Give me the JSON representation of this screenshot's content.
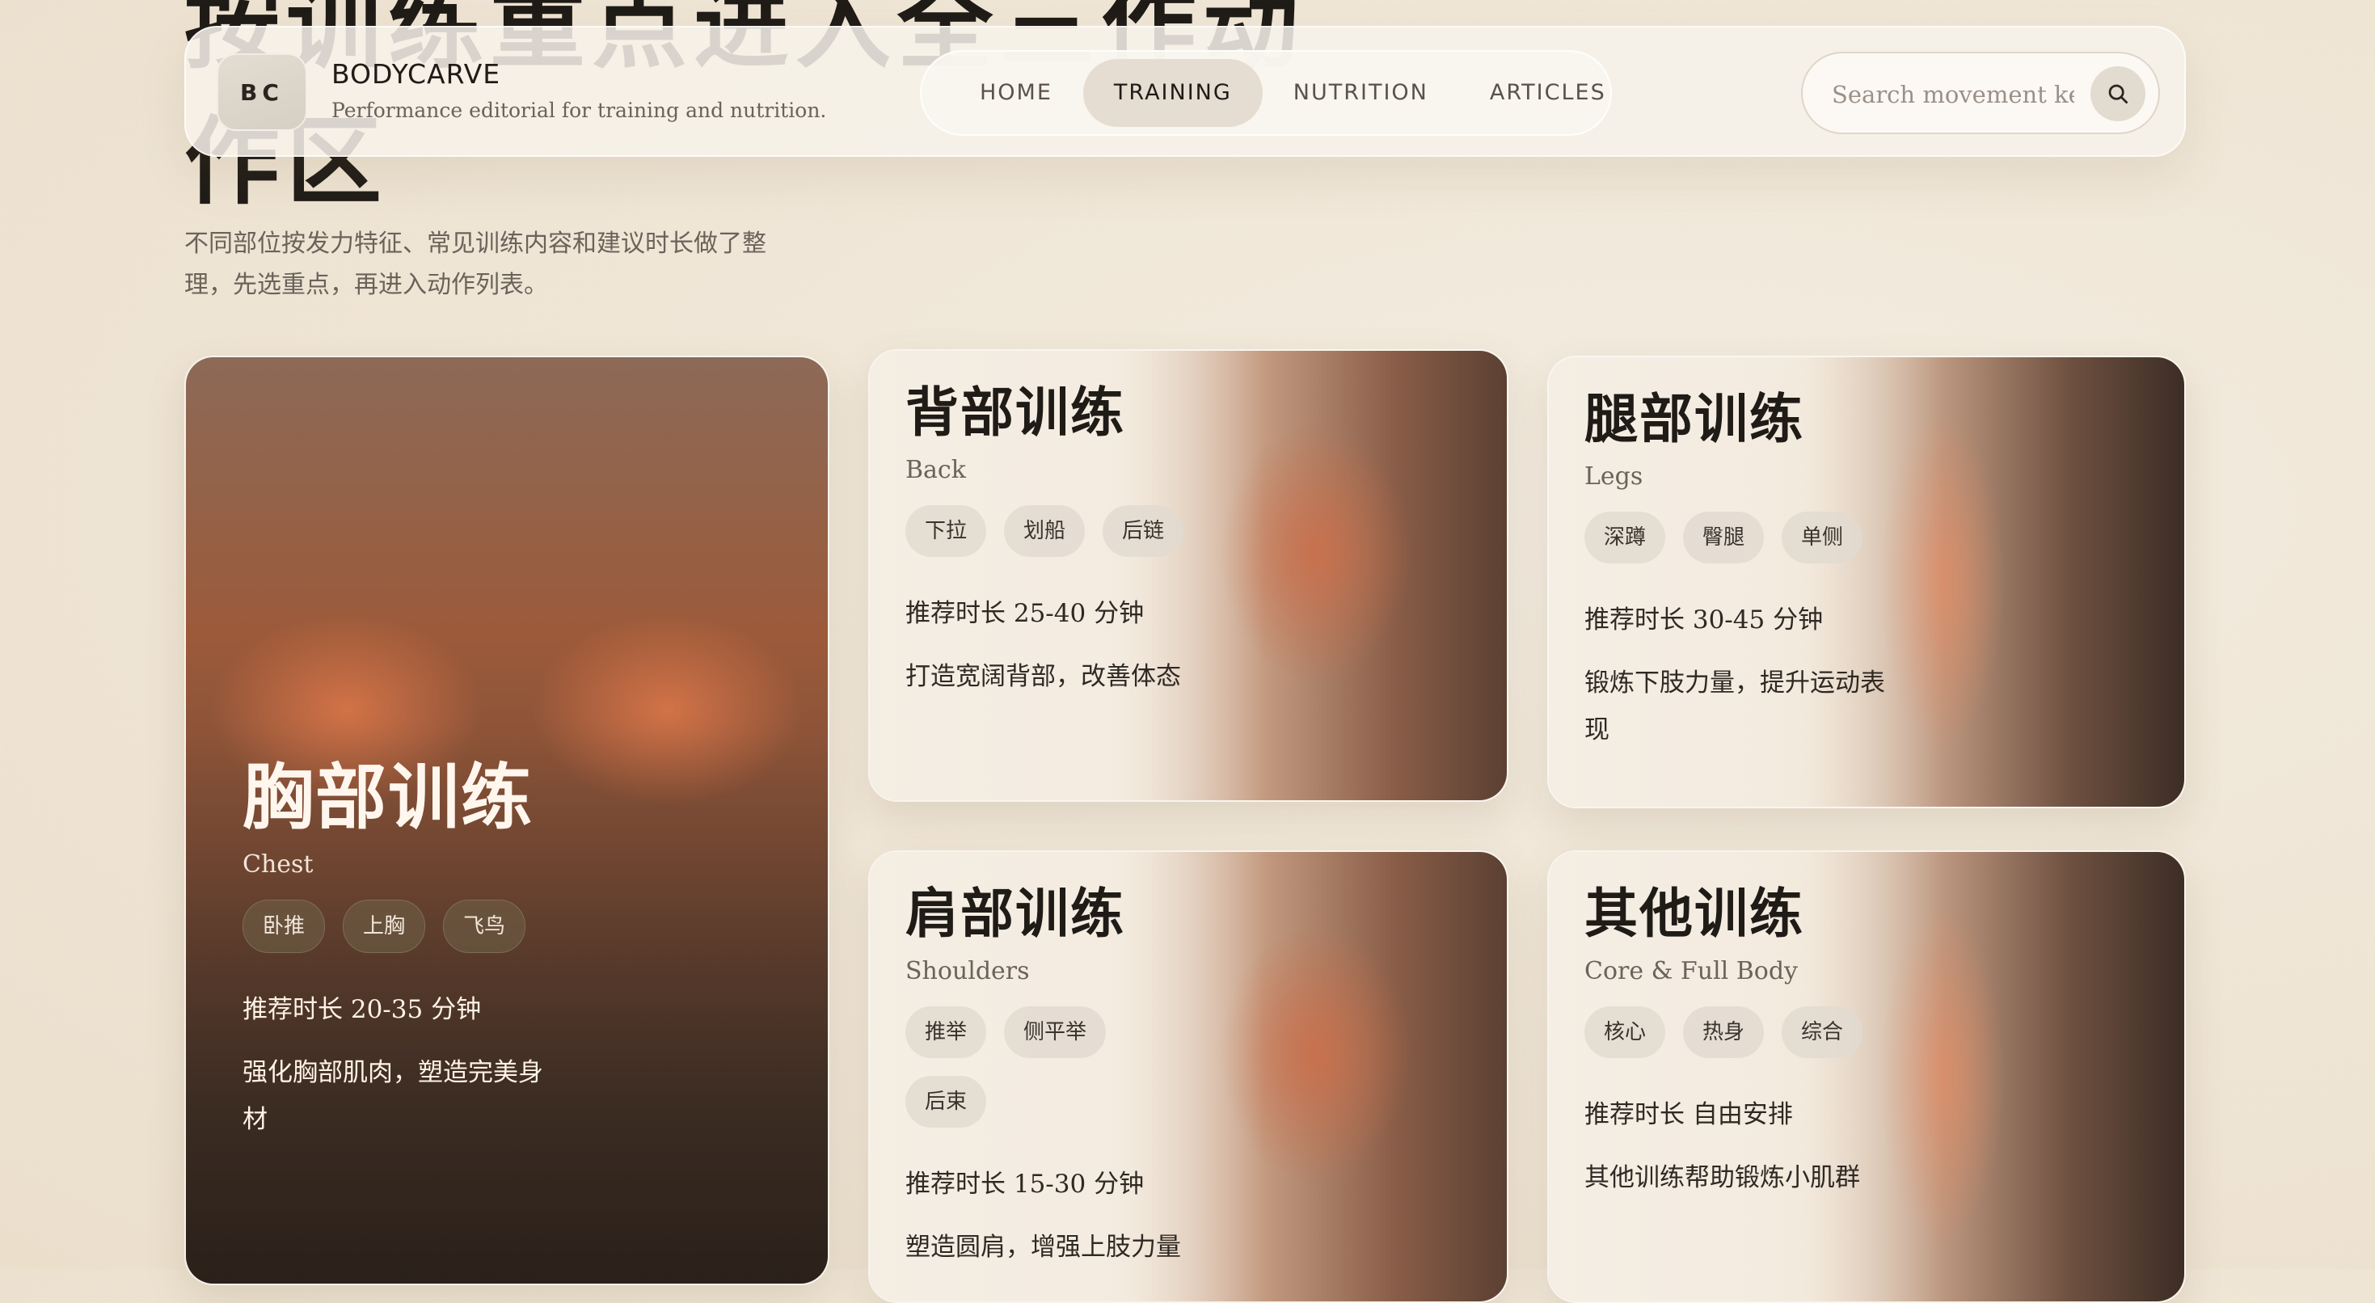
{
  "hero": {
    "title": "按训练重点进入全三作动作区",
    "description": "不同部位按发力特征、常见训练内容和建议时长做了整理，先选重点，再进入动作列表。"
  },
  "brand": {
    "badge": "BC",
    "name": "BODYCARVE",
    "tagline": "Performance editorial for training and nutrition."
  },
  "nav": {
    "items": [
      {
        "label": "HOME",
        "active": false
      },
      {
        "label": "TRAINING",
        "active": true
      },
      {
        "label": "NUTRITION",
        "active": false
      },
      {
        "label": "ARTICLES",
        "active": false
      }
    ]
  },
  "search": {
    "placeholder": "Search movement keywords",
    "icon": "search-icon"
  },
  "cards": {
    "chest": {
      "title": "胸部训练",
      "subtitle": "Chest",
      "tags": [
        "卧推",
        "上胸",
        "飞鸟"
      ],
      "duration": "推荐时长 20-35 分钟",
      "description": "强化胸部肌肉，塑造完美身材"
    },
    "back": {
      "title": "背部训练",
      "subtitle": "Back",
      "tags": [
        "下拉",
        "划船",
        "后链"
      ],
      "duration": "推荐时长 25-40 分钟",
      "description": "打造宽阔背部，改善体态"
    },
    "legs": {
      "title": "腿部训练",
      "subtitle": "Legs",
      "tags": [
        "深蹲",
        "臀腿",
        "单侧"
      ],
      "duration": "推荐时长 30-45 分钟",
      "description": "锻炼下肢力量，提升运动表现"
    },
    "shoulders": {
      "title": "肩部训练",
      "subtitle": "Shoulders",
      "tags": [
        "推举",
        "侧平举",
        "后束"
      ],
      "duration": "推荐时长 15-30 分钟",
      "description": "塑造圆肩，增强上肢力量"
    },
    "other": {
      "title": "其他训练",
      "subtitle": "Core & Full Body",
      "tags": [
        "核心",
        "热身",
        "综合"
      ],
      "duration": "推荐时长 自由安排",
      "description": "其他训练帮助锻炼小肌群"
    }
  }
}
